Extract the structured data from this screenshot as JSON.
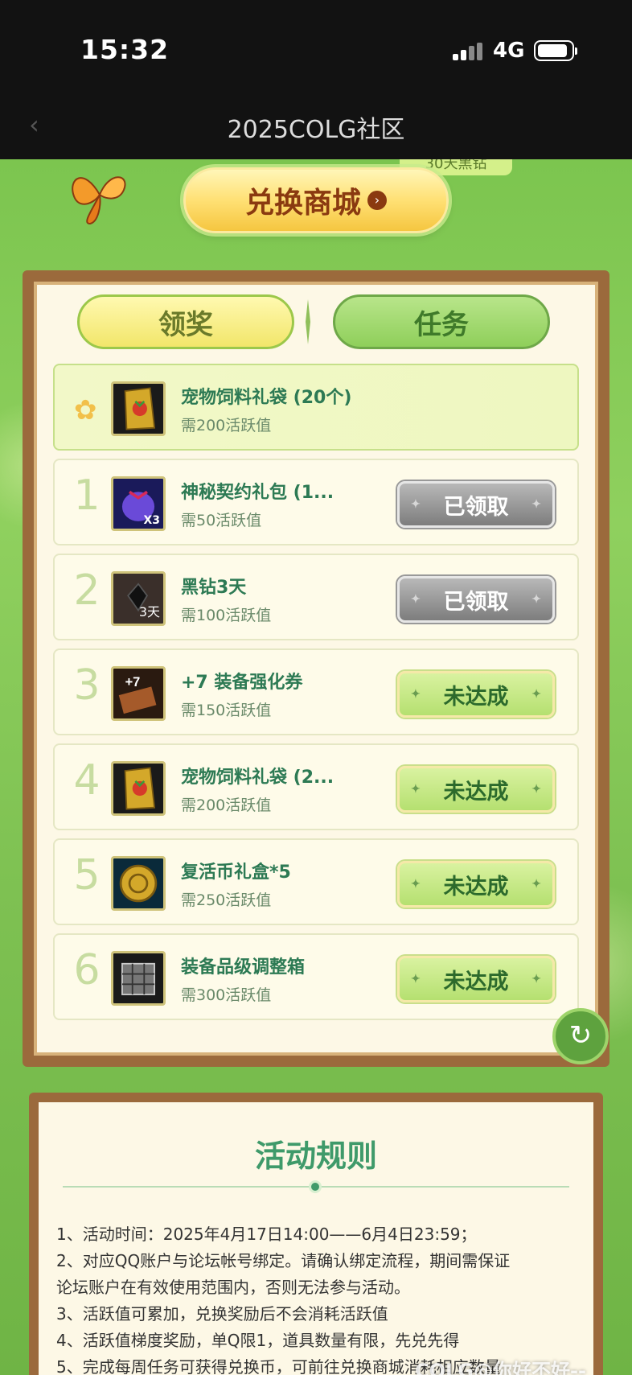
{
  "status_bar": {
    "time": "15:32",
    "network": "4G"
  },
  "nav": {
    "back_icon": "chevron-left-icon",
    "title": "2025COLG社区"
  },
  "banner": {
    "top_tag": "30天黑钻",
    "shop_button": "兑换商城"
  },
  "tabs": {
    "active": "领奖",
    "inactive": "任务"
  },
  "featured": {
    "name": "宠物饲料礼袋 (20个)",
    "req": "需200活跃值"
  },
  "rewards": [
    {
      "rank": "1",
      "name": "神秘契约礼包 (1...",
      "req": "需50活跃值",
      "button": "已领取",
      "state": "done"
    },
    {
      "rank": "2",
      "name": "黑钻3天",
      "req": "需100活跃值",
      "button": "已领取",
      "state": "done",
      "icon_label": "3天"
    },
    {
      "rank": "3",
      "name": "+7 装备强化券",
      "req": "需150活跃值",
      "button": "未达成",
      "state": "todo"
    },
    {
      "rank": "4",
      "name": "宠物饲料礼袋 (2...",
      "req": "需200活跃值",
      "button": "未达成",
      "state": "todo"
    },
    {
      "rank": "5",
      "name": "复活币礼盒*5",
      "req": "需250活跃值",
      "button": "未达成",
      "state": "todo"
    },
    {
      "rank": "6",
      "name": "装备品级调整箱",
      "req": "需300活跃值",
      "button": "未达成",
      "state": "todo"
    }
  ],
  "icons": {
    "mystery_bag_label": "X3"
  },
  "rules": {
    "title": "活动规则",
    "lines": [
      "1、活动时间：2025年4月17日14:00——6月4日23:59；",
      "2、对应QQ账户与论坛帐号绑定。请确认绑定流程，期间需保证",
      "论坛账户在有效使用范围内，否则无法参与活动。",
      "3、活跃值可累加，兑换奖励后不会消耗活跃值",
      "4、活跃值梯度奖励，单Q限1，道具数量有限，先兑先得",
      "5、完成每周任务可获得兑换币，可前往兑换商城消耗相应数量"
    ]
  },
  "watermark": "COLG@你好不好--"
}
